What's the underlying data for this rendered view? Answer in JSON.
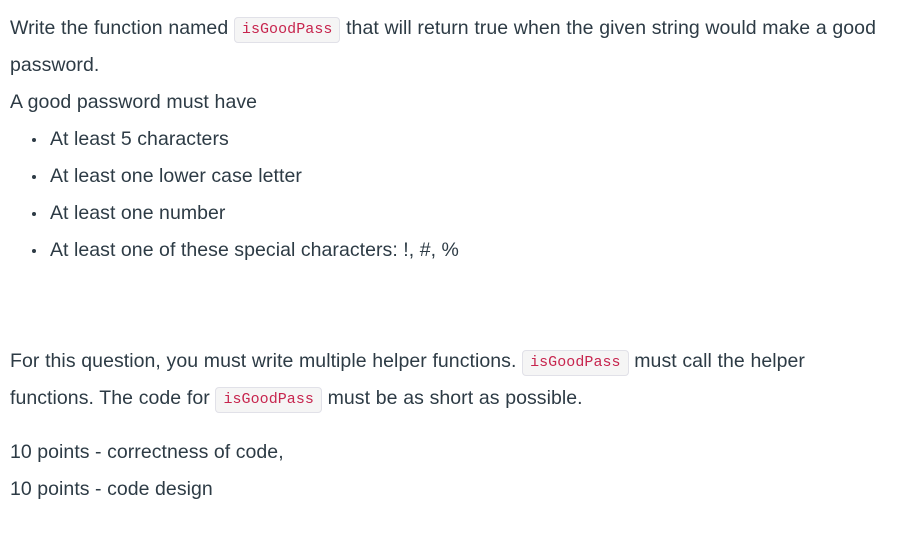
{
  "question": {
    "intro": {
      "before_code": "Write the function named ",
      "code": "isGoodPass",
      "after_code": " that will return true when the given string would make a good password."
    },
    "lead_in": "A good password must have",
    "requirements": [
      "At least 5 characters",
      "At least one lower case letter",
      "At least one number",
      "At least one of these special characters: !, #, %"
    ],
    "helpers": {
      "part1": "For this question, you must write multiple helper functions. ",
      "code1": "isGoodPass",
      "part2": " must call the helper functions. The code for ",
      "code2": "isGoodPass",
      "part3": " must be as short as possible."
    },
    "grading": [
      "10 points - correctness of code,",
      "10 points - code design"
    ]
  },
  "colors": {
    "text": "#2d3b45",
    "code_text": "#c7254e",
    "code_background": "#f5f5f5",
    "code_border": "#e1e1e8",
    "page_background": "#ffffff"
  }
}
